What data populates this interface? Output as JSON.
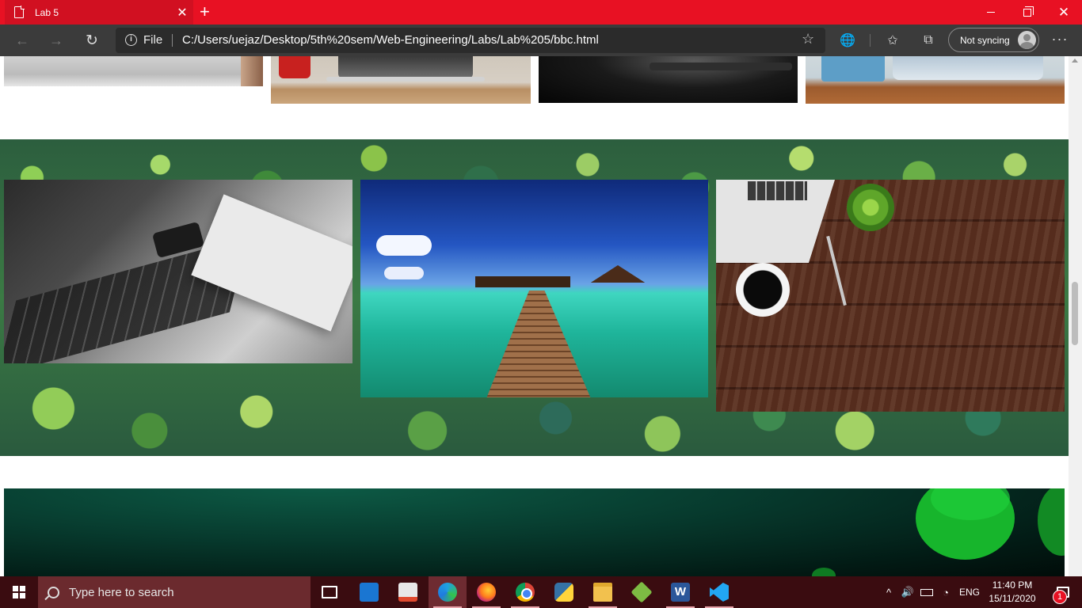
{
  "browser": {
    "tab_title": "Lab 5",
    "tab_close": "✕",
    "new_tab": "+",
    "window_buttons": {
      "minimize": "",
      "maximize": "",
      "close": "✕"
    },
    "nav": {
      "back": "←",
      "forward": "→",
      "reload": "↻"
    },
    "address": {
      "scheme_label": "File",
      "url": "C:/Users/uejaz/Desktop/5th%20sem/Web-Engineering/Labs/Lab%205/bbc.html"
    },
    "icons": {
      "star": "☆",
      "globe": "🌐",
      "favorites": "✩",
      "collections": "⧉",
      "more": "···"
    },
    "profile_button": "Not syncing",
    "accent_color": "#e81123"
  },
  "page": {
    "top_row_images": [
      "desk-grayscale",
      "laptop-red-mug",
      "dark-phone",
      "laptop-notepad-wood"
    ],
    "gallery_images": [
      "laptop-notebook-grayscale",
      "overwater-resort-boardwalk",
      "laptop-coffee-wooden-desk"
    ],
    "gallery_background": "forest-canopy",
    "banner_background": "dark-green-bubbles"
  },
  "taskbar": {
    "search_placeholder": "Type here to search",
    "apps": [
      "task-view",
      "mail",
      "store",
      "edge",
      "firefox",
      "chrome",
      "python",
      "file-explorer",
      "git",
      "word",
      "vscode"
    ],
    "active_app": "edge",
    "word_letter": "W",
    "tray": {
      "chevron": "^",
      "volume": "🔊",
      "wifi": "◔",
      "language": "ENG",
      "time": "11:40 PM",
      "date": "15/11/2020",
      "notification_count": "1"
    }
  }
}
